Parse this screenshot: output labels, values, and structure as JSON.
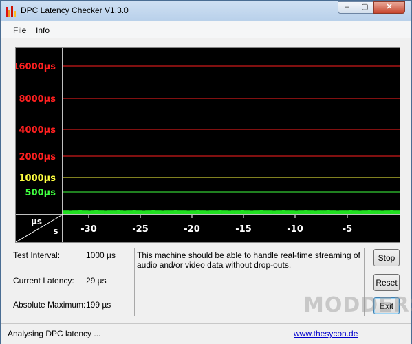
{
  "window": {
    "title": "DPC Latency Checker V1.3.0",
    "buttons": {
      "minimize": "–",
      "maximize": "▢",
      "close": "✕"
    }
  },
  "menu": [
    "File",
    "Info"
  ],
  "graph": {
    "y_labels": [
      {
        "text": "16000µs",
        "color": "#ff2020"
      },
      {
        "text": "8000µs",
        "color": "#ff2020"
      },
      {
        "text": "4000µs",
        "color": "#ff2020"
      },
      {
        "text": "2000µs",
        "color": "#ff2020"
      },
      {
        "text": "1000µs",
        "color": "#ffff40"
      },
      {
        "text": "500µs",
        "color": "#40ff40"
      }
    ],
    "axis_unit_y": "µs",
    "axis_unit_x": "s",
    "x_ticks": [
      "-30",
      "-25",
      "-20",
      "-15",
      "-10",
      "-5"
    ],
    "bar_values": [
      29,
      29,
      28,
      29,
      29,
      30,
      29,
      29,
      28,
      29,
      30,
      29,
      29,
      28,
      29,
      29,
      29,
      30,
      29,
      28,
      29,
      29,
      30,
      29,
      29,
      28,
      29,
      29,
      30,
      29,
      29,
      28,
      29,
      29,
      29,
      30,
      29,
      29,
      29,
      28,
      29,
      29,
      30,
      29,
      29,
      28,
      29,
      29,
      29,
      30,
      29,
      29,
      28,
      29,
      29,
      29,
      30,
      29,
      29,
      28,
      29,
      29,
      30,
      29,
      29,
      29,
      28,
      29,
      29,
      30,
      29,
      29,
      29,
      28,
      29,
      29,
      30,
      29,
      29,
      28,
      29,
      29,
      29,
      30,
      29,
      29,
      28,
      29,
      29,
      29,
      30,
      29,
      29,
      28,
      29,
      29,
      30,
      29,
      29,
      29,
      28,
      29,
      29,
      30,
      29,
      29
    ]
  },
  "info": {
    "test_interval_label": "Test Interval:",
    "test_interval_value": "1000 µs",
    "current_latency_label": "Current Latency:",
    "current_latency_value": "29 µs",
    "absolute_max_label": "Absolute Maximum:",
    "absolute_max_value": "199 µs"
  },
  "message": "This machine should be able to handle real-time streaming of audio and/or video data without drop-outs.",
  "buttons": {
    "stop": "Stop",
    "reset": "Reset",
    "exit": "Exit"
  },
  "status": {
    "text": "Analysing DPC latency ...",
    "link": "www.thesycon.de"
  },
  "watermark": "MODDERS"
}
